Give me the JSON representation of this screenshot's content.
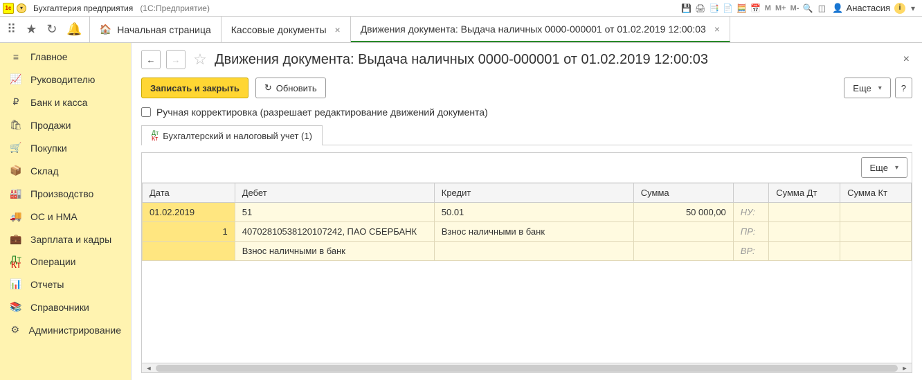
{
  "titlebar": {
    "app_name": "Бухгалтерия предприятия",
    "platform": "(1С:Предприятие)",
    "user": "Анастасия",
    "m_labels": [
      "M",
      "M+",
      "M-"
    ]
  },
  "tabs": {
    "home": "Начальная страница",
    "items": [
      {
        "label": "Кассовые документы",
        "active": false
      },
      {
        "label": "Движения документа: Выдача наличных 0000-000001 от 01.02.2019 12:00:03",
        "active": true
      }
    ]
  },
  "sidebar": [
    {
      "icon": "≡",
      "label": "Главное"
    },
    {
      "icon": "📈",
      "label": "Руководителю"
    },
    {
      "icon": "₽",
      "label": "Банк и касса"
    },
    {
      "icon": "🛍",
      "label": "Продажи"
    },
    {
      "icon": "🛒",
      "label": "Покупки"
    },
    {
      "icon": "📦",
      "label": "Склад"
    },
    {
      "icon": "🏭",
      "label": "Производство"
    },
    {
      "icon": "🚚",
      "label": "ОС и НМА"
    },
    {
      "icon": "💼",
      "label": "Зарплата и кадры"
    },
    {
      "icon": "ᴰᵀ",
      "label": "Операции"
    },
    {
      "icon": "📊",
      "label": "Отчеты"
    },
    {
      "icon": "📚",
      "label": "Справочники"
    },
    {
      "icon": "⚙",
      "label": "Администрирование"
    }
  ],
  "page": {
    "title": "Движения документа: Выдача наличных 0000-000001 от 01.02.2019 12:00:03",
    "save_close": "Записать и закрыть",
    "refresh": "Обновить",
    "more": "Еще",
    "help": "?",
    "manual_checkbox": "Ручная корректировка (разрешает редактирование движений документа)",
    "subtab": "Бухгалтерский и налоговый учет (1)"
  },
  "grid": {
    "headers": [
      "Дата",
      "Дебет",
      "Кредит",
      "Сумма",
      "",
      "Сумма Дт",
      "Сумма Кт"
    ],
    "row1": {
      "date": "01.02.2019",
      "debit": "51",
      "credit": "50.01",
      "sum": "50 000,00",
      "label": "НУ:"
    },
    "row2": {
      "n": "1",
      "debit": "40702810538120107242, ПАО СБЕРБАНК",
      "credit": "Взнос наличными в банк",
      "label": "ПР:"
    },
    "row3": {
      "debit": "Взнос наличными в банк",
      "label": "ВР:"
    }
  }
}
